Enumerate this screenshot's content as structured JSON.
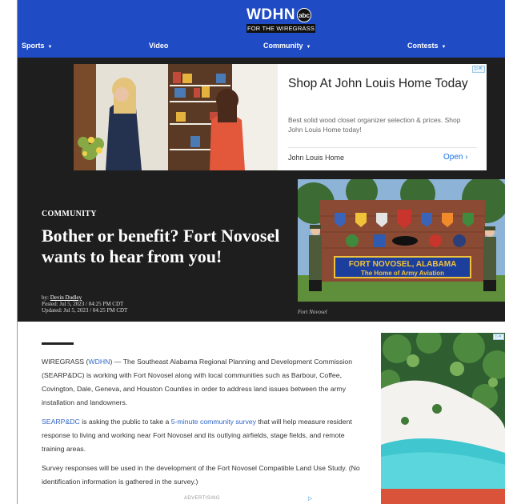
{
  "header": {
    "logo_text": "WDHN",
    "logo_badge": "abc",
    "logo_tagline": "FOR THE WIREGRASS",
    "nav": [
      {
        "label": "Sports",
        "dropdown": true
      },
      {
        "label": "Video",
        "dropdown": false
      },
      {
        "label": "Community",
        "dropdown": true
      },
      {
        "label": "Contests",
        "dropdown": true
      }
    ]
  },
  "top_ad": {
    "title": "Shop At John Louis Home Today",
    "description": "Best solid wood closet organizer selection & prices. Shop John Louis Home today!",
    "advertiser": "John Louis Home",
    "cta": "Open"
  },
  "article": {
    "category": "COMMUNITY",
    "headline": "Bother or benefit? Fort Novosel wants to hear from you!",
    "by_prefix": "by:",
    "author": "Devin Dudley",
    "posted": "Posted: Jul 5, 2023 / 04:25 PM CDT",
    "updated": "Updated: Jul 5, 2023 / 04:25 PM CDT",
    "photo_caption": "Fort Novosel",
    "sign_line1": "FORT NOVOSEL, ALABAMA",
    "sign_line2": "The Home of Army Aviation",
    "p1_dateline": "WIREGRASS (",
    "p1_link": "WDHN",
    "p1_text": ") — The Southeast Alabama Regional Planning and Development Commission (SEARP&DC) is working with Fort Novosel along with local communities such as Barbour, Coffee, Covington, Dale, Geneva, and Houston Counties in order to address land issues between the army installation and landowners.",
    "p2_link1": "SEARP&DC",
    "p2_text1": " is asking the public to take a ",
    "p2_link2": "5-minute community survey",
    "p2_text2": " that will help measure resident response to living and working near Fort Novosel and its outlying airfields, stage fields, and remote training areas.",
    "p3_text": "Survey responses will be used in the development of the Fort Novosel Compatible Land Use Study. (No identification information is gathered in the survey.)",
    "advertising_label": "ADVERTISING"
  },
  "colors": {
    "brand_blue": "#1f4bc4",
    "hero_bg": "#1e1e1e",
    "link": "#2f66c7"
  }
}
